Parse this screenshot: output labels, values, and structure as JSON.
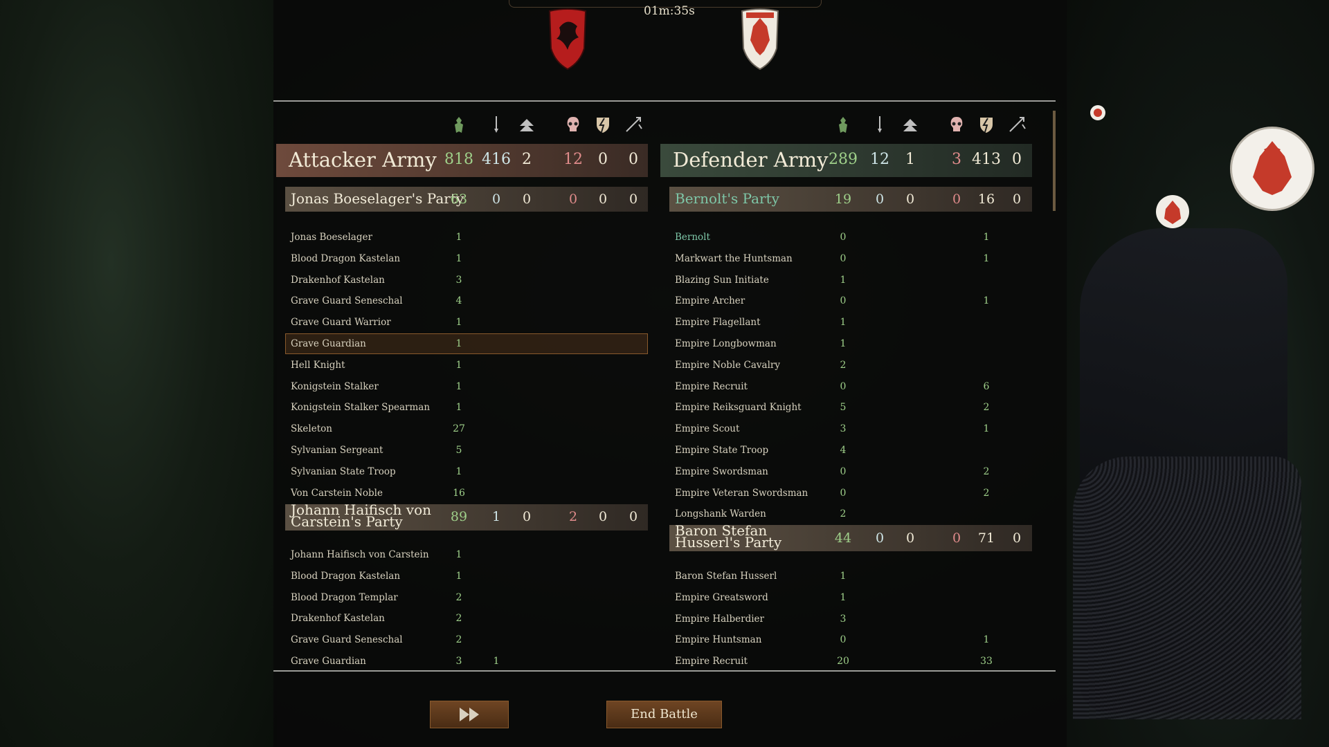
{
  "timer": "01m:35s",
  "attacker": {
    "title": "Attacker Army",
    "stats": [
      "818",
      "416",
      "2",
      "12",
      "0",
      "0"
    ],
    "parties": [
      {
        "title": "Jonas Boeselager's Party",
        "stats": [
          "63",
          "0",
          "0",
          "0",
          "0",
          "0"
        ],
        "rows": [
          {
            "name": "Jonas Boeselager",
            "a": "1",
            "b": "",
            "c": ""
          },
          {
            "name": "Blood Dragon Kastelan",
            "a": "1",
            "b": "",
            "c": ""
          },
          {
            "name": "Drakenhof Kastelan",
            "a": "3",
            "b": "",
            "c": ""
          },
          {
            "name": "Grave Guard Seneschal",
            "a": "4",
            "b": "",
            "c": ""
          },
          {
            "name": "Grave Guard Warrior",
            "a": "1",
            "b": "",
            "c": ""
          },
          {
            "name": "Grave Guardian",
            "a": "1",
            "b": "",
            "c": ""
          },
          {
            "name": "Hell Knight",
            "a": "1",
            "b": "",
            "c": ""
          },
          {
            "name": "Konigstein Stalker",
            "a": "1",
            "b": "",
            "c": ""
          },
          {
            "name": "Konigstein Stalker Spearman",
            "a": "1",
            "b": "",
            "c": ""
          },
          {
            "name": "Skeleton",
            "a": "27",
            "b": "",
            "c": ""
          },
          {
            "name": "Sylvanian Sergeant",
            "a": "5",
            "b": "",
            "c": ""
          },
          {
            "name": "Sylvanian State Troop",
            "a": "1",
            "b": "",
            "c": ""
          },
          {
            "name": "Von Carstein Noble",
            "a": "16",
            "b": "",
            "c": ""
          }
        ]
      },
      {
        "title": "Johann Haifisch von Carstein's Party",
        "stats": [
          "89",
          "1",
          "0",
          "2",
          "0",
          "0"
        ],
        "rows": [
          {
            "name": "Johann Haifisch von Carstein",
            "a": "1",
            "b": "",
            "c": ""
          },
          {
            "name": "Blood Dragon Kastelan",
            "a": "1",
            "b": "",
            "c": ""
          },
          {
            "name": "Blood Dragon Templar",
            "a": "2",
            "b": "",
            "c": ""
          },
          {
            "name": "Drakenhof Kastelan",
            "a": "2",
            "b": "",
            "c": ""
          },
          {
            "name": "Grave Guard Seneschal",
            "a": "2",
            "b": "",
            "c": ""
          },
          {
            "name": "Grave Guardian",
            "a": "3",
            "b": "1",
            "c": ""
          }
        ]
      }
    ]
  },
  "defender": {
    "title": "Defender Army",
    "stats": [
      "289",
      "12",
      "1",
      "3",
      "413",
      "0"
    ],
    "parties": [
      {
        "title": "Bernolt's Party",
        "stats": [
          "19",
          "0",
          "0",
          "0",
          "16",
          "0"
        ],
        "rows": [
          {
            "name": "Bernolt",
            "a": "0",
            "b": "",
            "c": "1"
          },
          {
            "name": "Markwart the Huntsman",
            "a": "0",
            "b": "",
            "c": "1"
          },
          {
            "name": "Blazing Sun Initiate",
            "a": "1",
            "b": "",
            "c": ""
          },
          {
            "name": "Empire Archer",
            "a": "0",
            "b": "",
            "c": "1"
          },
          {
            "name": "Empire Flagellant",
            "a": "1",
            "b": "",
            "c": ""
          },
          {
            "name": "Empire Longbowman",
            "a": "1",
            "b": "",
            "c": ""
          },
          {
            "name": "Empire Noble Cavalry",
            "a": "2",
            "b": "",
            "c": ""
          },
          {
            "name": "Empire Recruit",
            "a": "0",
            "b": "",
            "c": "6"
          },
          {
            "name": "Empire Reiksguard Knight",
            "a": "5",
            "b": "",
            "c": "2"
          },
          {
            "name": "Empire Scout",
            "a": "3",
            "b": "",
            "c": "1"
          },
          {
            "name": "Empire State Troop",
            "a": "4",
            "b": "",
            "c": ""
          },
          {
            "name": "Empire Swordsman",
            "a": "0",
            "b": "",
            "c": "2"
          },
          {
            "name": "Empire Veteran Swordsman",
            "a": "0",
            "b": "",
            "c": "2"
          },
          {
            "name": "Longshank Warden",
            "a": "2",
            "b": "",
            "c": ""
          }
        ]
      },
      {
        "title": "Baron Stefan Husserl's Party",
        "stats": [
          "44",
          "0",
          "0",
          "0",
          "71",
          "0"
        ],
        "rows": [
          {
            "name": "Baron Stefan Husserl",
            "a": "1",
            "b": "",
            "c": ""
          },
          {
            "name": "Empire Greatsword",
            "a": "1",
            "b": "",
            "c": ""
          },
          {
            "name": "Empire Halberdier",
            "a": "3",
            "b": "",
            "c": ""
          },
          {
            "name": "Empire Huntsman",
            "a": "0",
            "b": "",
            "c": "1"
          },
          {
            "name": "Empire Recruit",
            "a": "20",
            "b": "",
            "c": "33"
          }
        ]
      }
    ]
  },
  "buttons": {
    "fast_forward_icon": "fast-forward-icon",
    "end_battle": "End Battle"
  },
  "colors": {
    "green": "#9fd08a",
    "red": "#e08b8b",
    "cream": "#f1ead6",
    "accent": "#7ec7a8"
  }
}
